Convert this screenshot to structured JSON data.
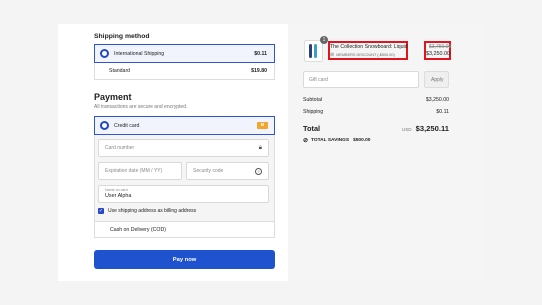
{
  "shipping": {
    "title": "Shipping method",
    "options": [
      {
        "label": "International Shipping",
        "price": "$0.11"
      },
      {
        "label": "Standard",
        "price": "$19.80"
      }
    ]
  },
  "payment": {
    "title": "Payment",
    "subtitle": "All transactions are secure and encrypted.",
    "credit_card_label": "Credit card",
    "card_badge": "B",
    "card_number_placeholder": "Card number",
    "expiration_placeholder": "Expiration date (MM / YY)",
    "security_code_placeholder": "Security code",
    "name_label": "Name on card",
    "name_value": "User Alpha",
    "billing_checkbox_label": "Use shipping address as billing address",
    "cod_label": "Cash on Delivery (COD)",
    "pay_button": "Pay now"
  },
  "summary": {
    "product": {
      "quantity": "1",
      "name": "The Collection Snowboard: Liquid",
      "discount": "MEMBERS DISCOUNT (-$500.00)",
      "original_price": "$3,750.00",
      "final_price": "$3,250.00"
    },
    "gift_card_placeholder": "Gift card",
    "apply_button": "Apply",
    "subtotal_label": "Subtotal",
    "subtotal_value": "$3,250.00",
    "shipping_label": "Shipping",
    "shipping_value": "$0.11",
    "total_label": "Total",
    "currency": "USD",
    "total_value": "$3,250.11",
    "savings_label": "TOTAL SAVINGS",
    "savings_value": "$500.00"
  },
  "colors": {
    "accent": "#1f52cf",
    "highlight_box": "#e0141e",
    "card_badge": "#f2a62b"
  }
}
